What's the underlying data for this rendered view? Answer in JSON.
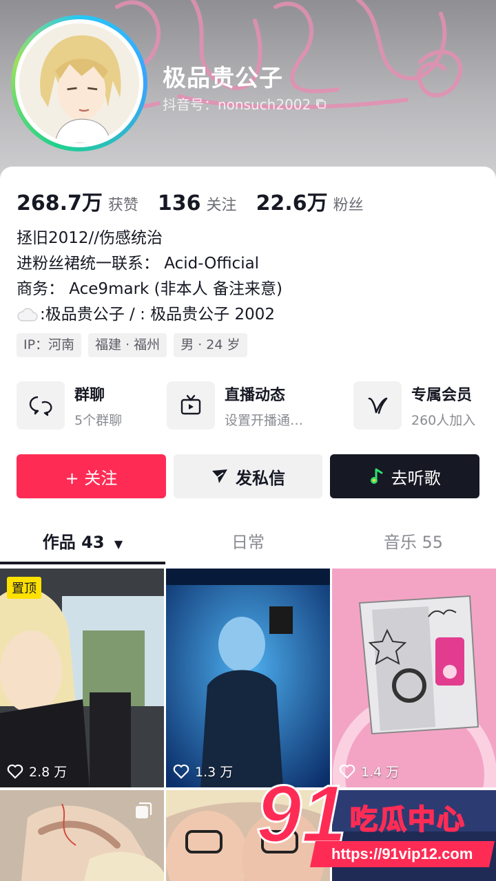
{
  "profile": {
    "nickname": "极品贵公子",
    "douyin_id": "抖音号：nonsuch2002"
  },
  "stats": [
    {
      "value": "268.7万",
      "label": "获赞"
    },
    {
      "value": "136",
      "label": "关注"
    },
    {
      "value": "22.6万",
      "label": "粉丝"
    }
  ],
  "bio": {
    "line1": "拯旧2012//伤感统治",
    "line2": "进粉丝裙统一联系：  Acid-Official",
    "line3": "商务：  Ace9mark (非本人 备注来意)",
    "line4": ":极品贵公子 /  :  极品贵公子 2002"
  },
  "tags": [
    "IP：河南",
    "福建 · 福州",
    "男 · 24 岁"
  ],
  "features": [
    {
      "title": "群聊",
      "subtitle": "5个群聊",
      "icon": "chat-bubble-icon"
    },
    {
      "title": "直播动态",
      "subtitle": "设置开播通…",
      "icon": "tv-icon"
    },
    {
      "title": "专属会员",
      "subtitle": "260人加入",
      "icon": "vip-v-icon"
    }
  ],
  "actions": {
    "follow": "+ 关注",
    "message": "发私信",
    "music": "去听歌"
  },
  "tabs": [
    {
      "label": "作品 43"
    },
    {
      "label": "日常"
    },
    {
      "label": "音乐 55"
    }
  ],
  "videos": [
    {
      "likes": "2.8 万",
      "pinned": "置顶"
    },
    {
      "likes": "1.3 万"
    },
    {
      "likes": "1.4 万"
    }
  ],
  "watermark": {
    "number": "91",
    "name": "吃瓜中心",
    "url": "https://91vip12.com"
  },
  "colors": {
    "accent": "#fe2c55",
    "dark": "#161823",
    "pin": "#ffe100"
  }
}
